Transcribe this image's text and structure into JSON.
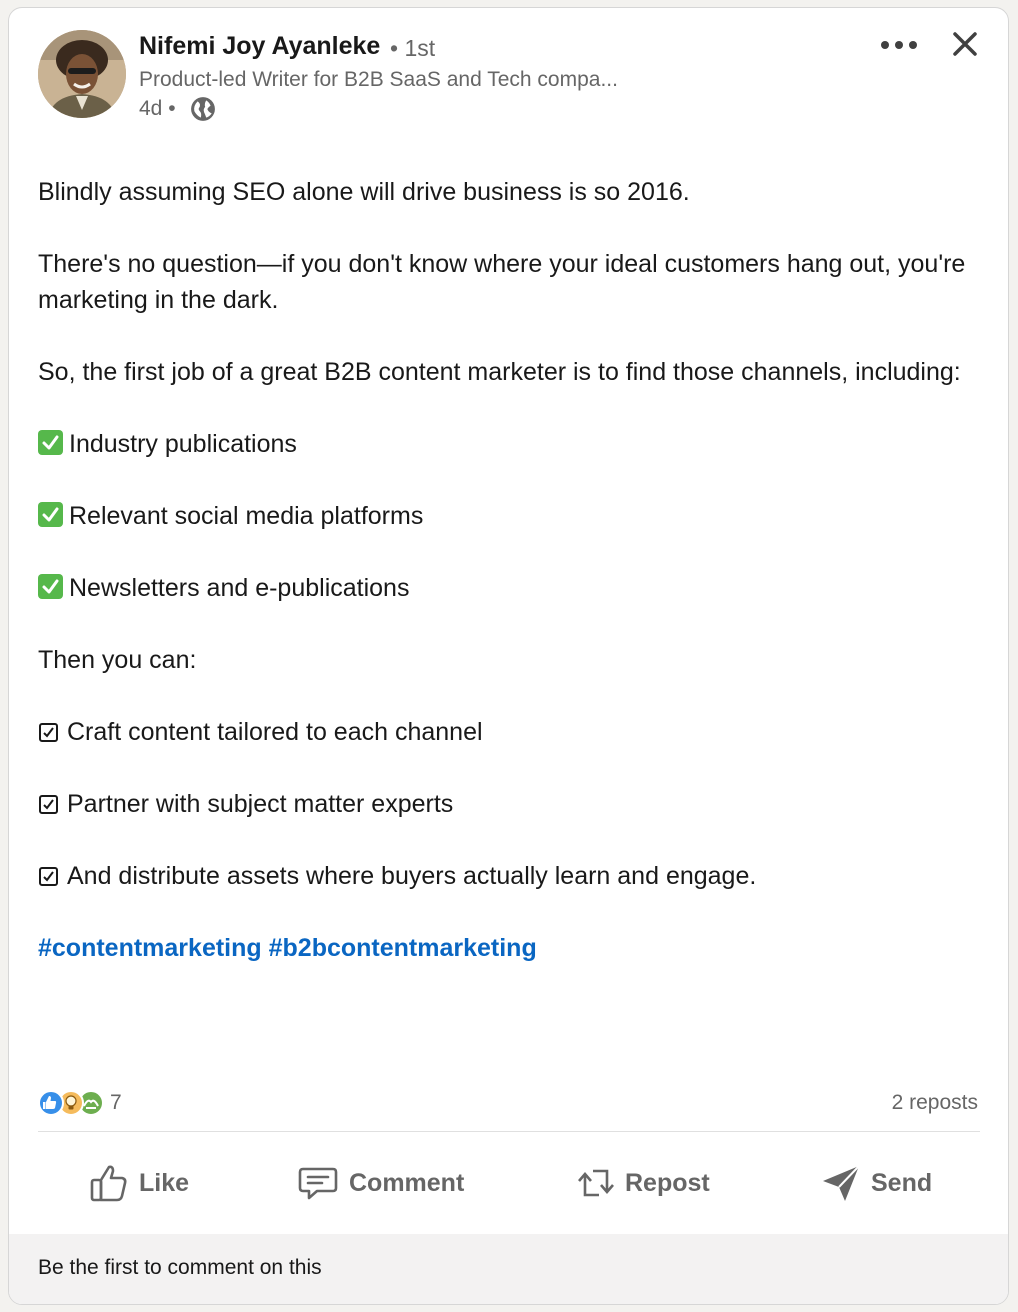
{
  "author": {
    "name": "Nifemi Joy Ayanleke",
    "degree": "• 1st",
    "headline": "Product-led Writer for B2B SaaS and Tech compa...",
    "time": "4d •",
    "visibility_icon": "globe-icon"
  },
  "header": {
    "more_icon": "more-horizontal-icon",
    "close_icon": "close-icon"
  },
  "post": {
    "intro": "Blindly assuming SEO alone will drive business is so 2016.",
    "para2": "There's no question—if you don't know where your ideal customers hang out, you're marketing in the dark.",
    "para3": "So, the first job of a great B2B content marketer is to find those channels, including:",
    "channels": [
      "Industry publications",
      "Relevant social media platforms",
      "Newsletters and e-publications"
    ],
    "then": "Then you can:",
    "actions": [
      "Craft content tailored to each channel",
      "Partner with subject matter experts",
      "And distribute assets where buyers actually learn and engage."
    ],
    "hashtags": [
      "#contentmarketing",
      "#b2bcontentmarketing"
    ]
  },
  "social": {
    "reaction_icons": [
      "like-reaction-icon",
      "insightful-reaction-icon",
      "support-reaction-icon"
    ],
    "reaction_count": "7",
    "reposts": "2 reposts"
  },
  "actions": {
    "like": "Like",
    "comment": "Comment",
    "repost": "Repost",
    "send": "Send"
  },
  "footer": {
    "text": "Be the first to comment on this"
  },
  "colors": {
    "link": "#0a66c2",
    "muted": "#666666",
    "check_green": "#56b84b"
  }
}
